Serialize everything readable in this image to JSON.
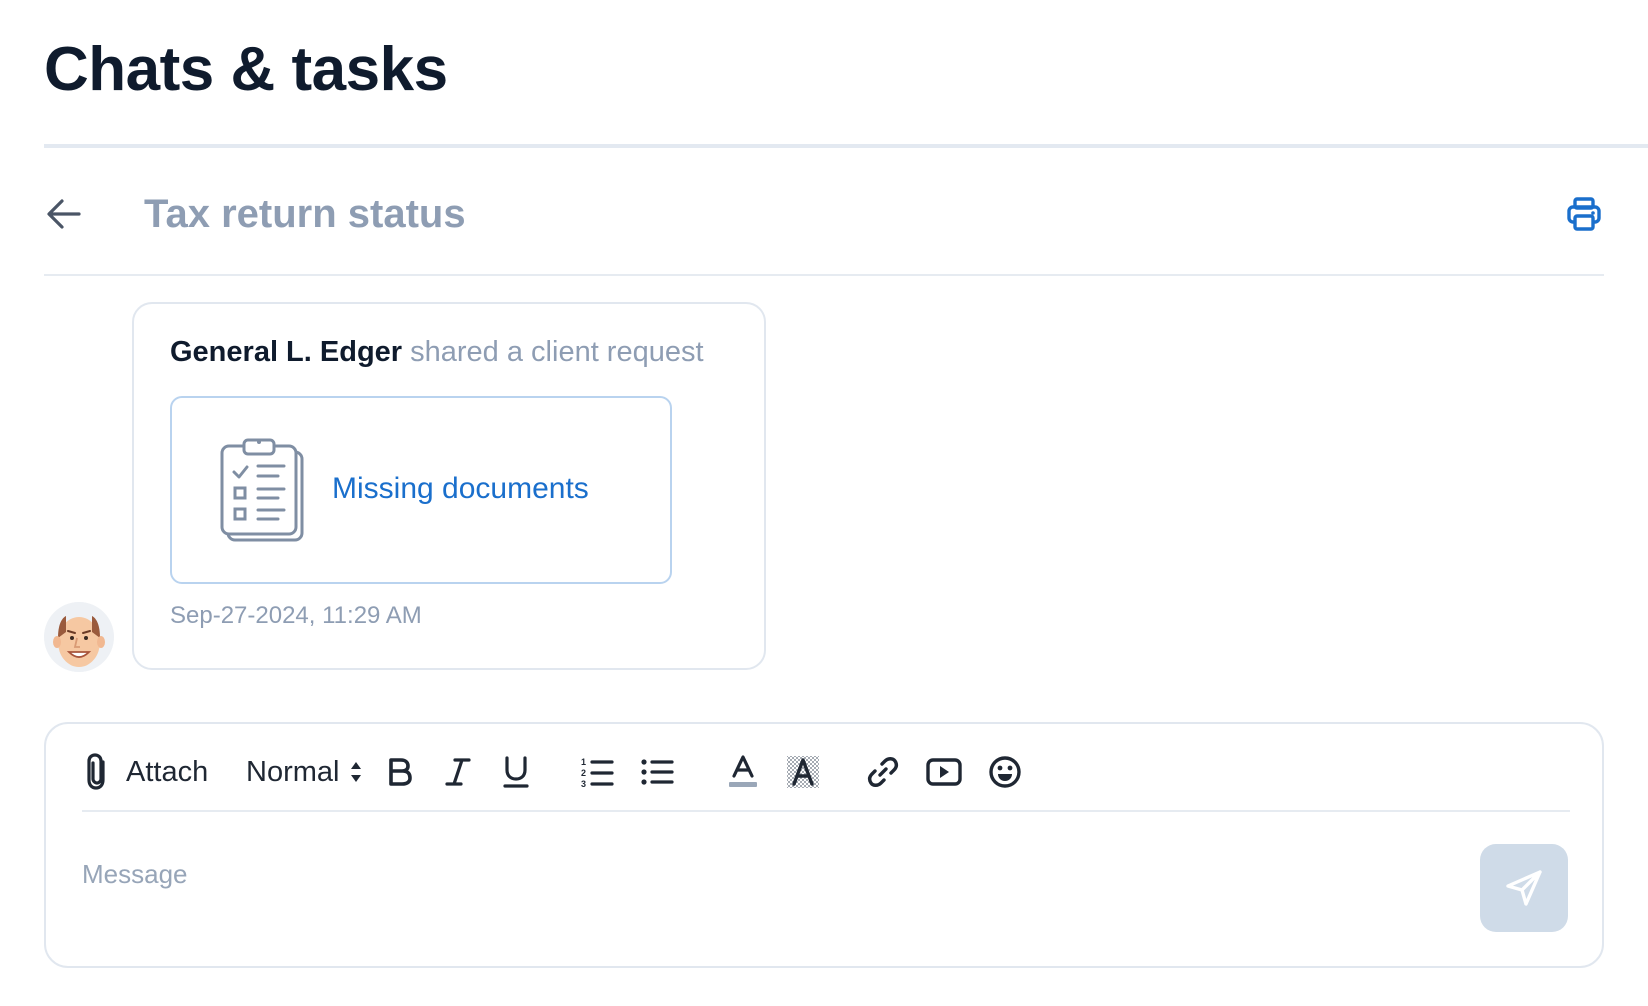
{
  "page": {
    "title": "Chats & tasks"
  },
  "thread": {
    "title": "Tax return status",
    "back_icon": "arrow-left-icon",
    "print_icon": "printer-icon"
  },
  "message": {
    "sender": "General L. Edger",
    "action": "shared a client request",
    "request_label": "Missing documents",
    "request_icon": "clipboard-checklist-icon",
    "timestamp": "Sep-27-2024, 11:29 AM",
    "avatar_icon": "user-avatar"
  },
  "composer": {
    "attach_label": "Attach",
    "format_value": "Normal",
    "placeholder": "Message",
    "toolbar_icons": [
      "paperclip-icon",
      "bold-icon",
      "italic-icon",
      "underline-icon",
      "ordered-list-icon",
      "bullet-list-icon",
      "text-color-icon",
      "highlight-icon",
      "link-icon",
      "video-icon",
      "emoji-icon"
    ],
    "send_icon": "send-icon"
  },
  "colors": {
    "title": "#0f1b2d",
    "muted": "#8e9db3",
    "accent": "#1a6fcc",
    "send_button": "#cfdbe8"
  }
}
